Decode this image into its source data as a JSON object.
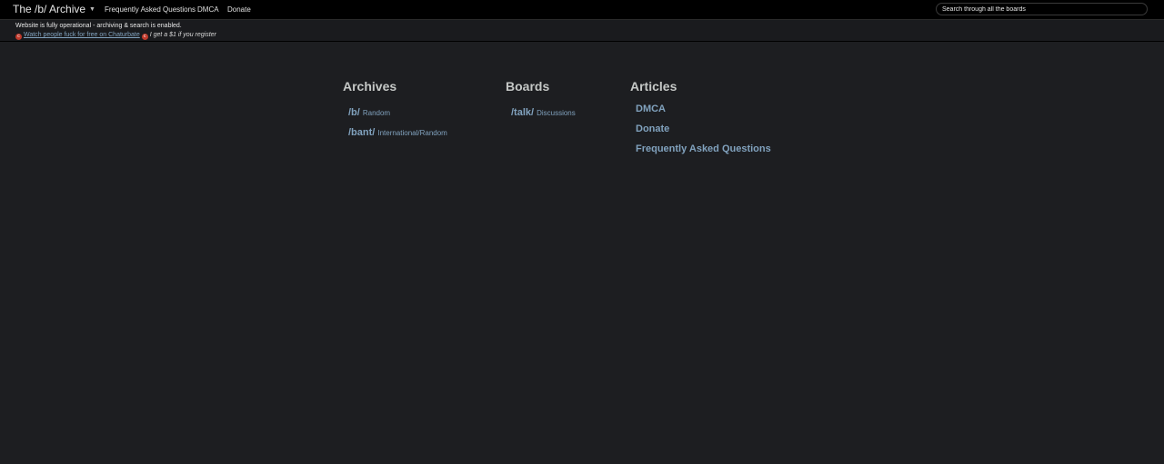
{
  "header": {
    "brand": "The /b/ Archive",
    "nav": {
      "faq": "Frequently Asked Questions",
      "dmca": "DMCA",
      "donate": "Donate"
    },
    "search": {
      "placeholder": "Search through all the boards"
    }
  },
  "notice": {
    "status": "Website is fully operational - archiving & search is enabled.",
    "promo_link": "Watch people fuck for free on Chaturbate",
    "promo_note": "I get a $1 if you register"
  },
  "archives": {
    "title": "Archives",
    "items": [
      {
        "code": "/b/",
        "desc": "Random"
      },
      {
        "code": "/bant/",
        "desc": "International/Random"
      }
    ]
  },
  "boards": {
    "title": "Boards",
    "items": [
      {
        "code": "/talk/",
        "desc": "Discussions"
      }
    ]
  },
  "articles": {
    "title": "Articles",
    "items": [
      "DMCA",
      "Donate",
      "Frequently Asked Questions"
    ]
  },
  "colors": {
    "background": "#1d1e21",
    "topbar": "#000000",
    "link": "#81a2be",
    "heading": "#c5c8c6"
  },
  "icons": {
    "promo_badges": "chaturbate-icon",
    "brand_caret": "caret-down-icon"
  }
}
